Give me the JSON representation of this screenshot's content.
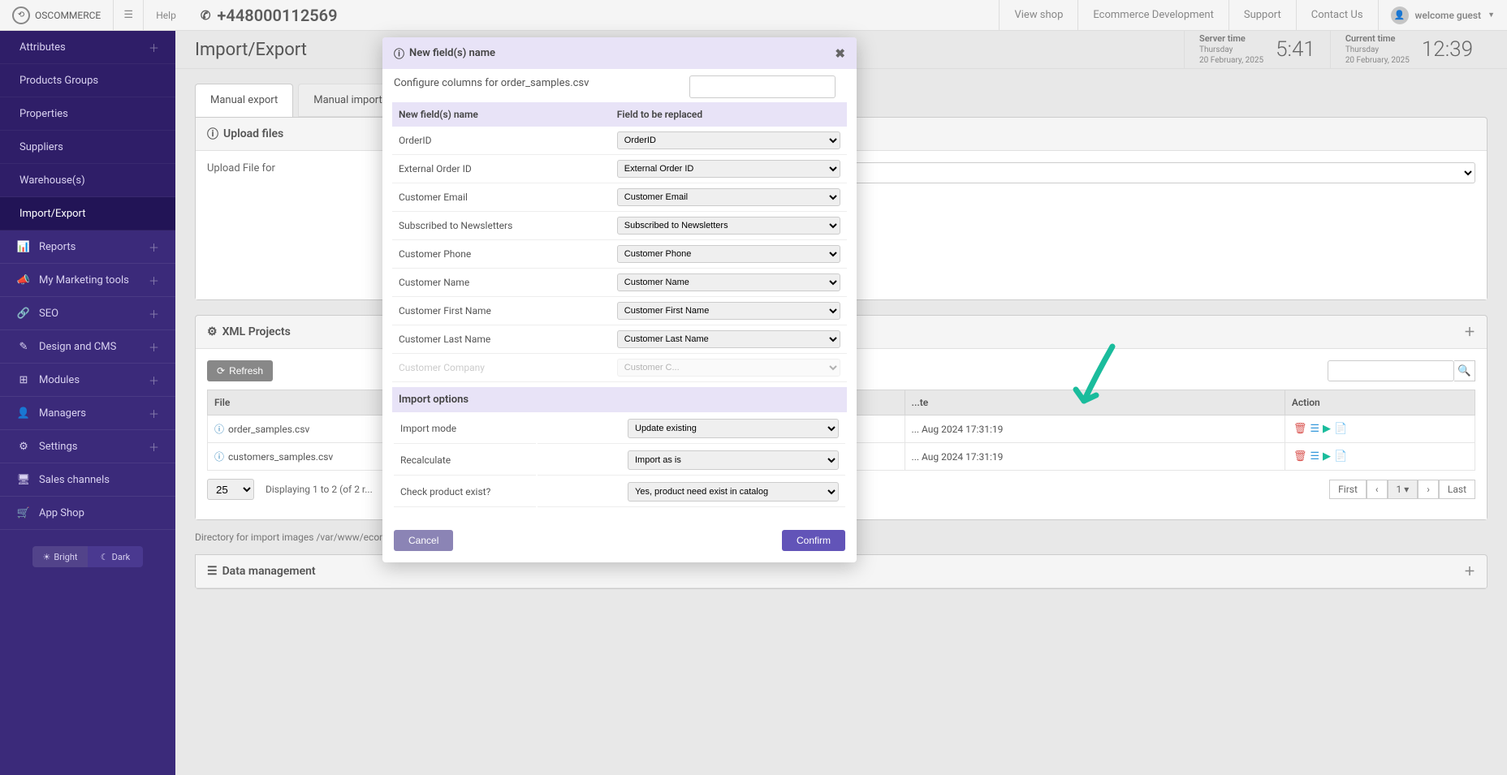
{
  "topbar": {
    "logo_text": "OSCOMMERCE",
    "help": "Help",
    "phone": "+448000112569",
    "view_shop": "View shop",
    "ecommerce_dev": "Ecommerce Development",
    "support": "Support",
    "contact": "Contact Us",
    "welcome": "welcome guest"
  },
  "sidebar": {
    "items": [
      {
        "label": "Attributes",
        "icon": "",
        "expandable": true,
        "sub": true
      },
      {
        "label": "Products Groups",
        "icon": "",
        "sub": true
      },
      {
        "label": "Properties",
        "icon": "",
        "sub": true
      },
      {
        "label": "Suppliers",
        "icon": "",
        "sub": true
      },
      {
        "label": "Warehouse(s)",
        "icon": "",
        "sub": true
      },
      {
        "label": "Import/Export",
        "icon": "",
        "sub": true,
        "active": true
      },
      {
        "label": "Reports",
        "icon": "📊",
        "expandable": true
      },
      {
        "label": "My Marketing tools",
        "icon": "📣",
        "expandable": true
      },
      {
        "label": "SEO",
        "icon": "🔗",
        "expandable": true
      },
      {
        "label": "Design and CMS",
        "icon": "✎",
        "expandable": true
      },
      {
        "label": "Modules",
        "icon": "⊞",
        "expandable": true
      },
      {
        "label": "Managers",
        "icon": "👤",
        "expandable": true
      },
      {
        "label": "Settings",
        "icon": "⚙",
        "expandable": true
      },
      {
        "label": "Sales channels",
        "icon": "🖥"
      },
      {
        "label": "App Shop",
        "icon": "🛒"
      }
    ],
    "bright": "Bright",
    "dark": "Dark"
  },
  "page": {
    "title": "Import/Export",
    "server_time_label": "Server time",
    "server_day": "Thursday",
    "server_date": "20 February, 2025",
    "server_time": "5:41",
    "current_time_label": "Current time",
    "current_day": "Thursday",
    "current_date": "20 February, 2025",
    "current_time": "12:39"
  },
  "tabs": {
    "export": "Manual export",
    "import": "Manual import"
  },
  "upload": {
    "header": "Upload files",
    "label": "Upload File for"
  },
  "xml": {
    "header": "XML Projects",
    "refresh": "Refresh",
    "col_file": "File",
    "col_date": "...te",
    "col_action": "Action",
    "rows": [
      {
        "file": "order_samples.csv",
        "date": "... Aug 2024 17:31:19"
      },
      {
        "file": "customers_samples.csv",
        "date": "... Aug 2024 17:31:19"
      }
    ],
    "page_size": "25",
    "displaying": "Displaying 1 to 2 (of 2 r...",
    "first": "First",
    "page": "1",
    "last": "Last"
  },
  "directory_note": "Directory for import images /var/www/ecommerce/shop/wordpress/oscommerce/ep_files/manual_import/images/",
  "data_mgmt": {
    "header": "Data management"
  },
  "modal": {
    "title": "New field(s) name",
    "subtitle": "Configure columns for order_samples.csv",
    "col_new": "New field(s) name",
    "col_replace": "Field to be replaced",
    "rows": [
      {
        "name": "OrderID",
        "replace": "OrderID"
      },
      {
        "name": "External Order ID",
        "replace": "External Order ID"
      },
      {
        "name": "Customer Email",
        "replace": "Customer Email"
      },
      {
        "name": "Subscribed to Newsletters",
        "replace": "Subscribed to Newsletters"
      },
      {
        "name": "Customer Phone",
        "replace": "Customer Phone"
      },
      {
        "name": "Customer Name",
        "replace": "Customer Name"
      },
      {
        "name": "Customer First Name",
        "replace": "Customer First Name"
      },
      {
        "name": "Customer Last Name",
        "replace": "Customer Last Name"
      },
      {
        "name": "Customer Company",
        "replace": "Customer C..."
      }
    ],
    "import_options": "Import options",
    "opt_mode_label": "Import mode",
    "opt_mode_value": "Update existing",
    "opt_recalc_label": "Recalculate",
    "opt_recalc_value": "Import as is",
    "opt_check_label": "Check product exist?",
    "opt_check_value": "Yes, product need exist in catalog",
    "cancel": "Cancel",
    "confirm": "Confirm"
  }
}
